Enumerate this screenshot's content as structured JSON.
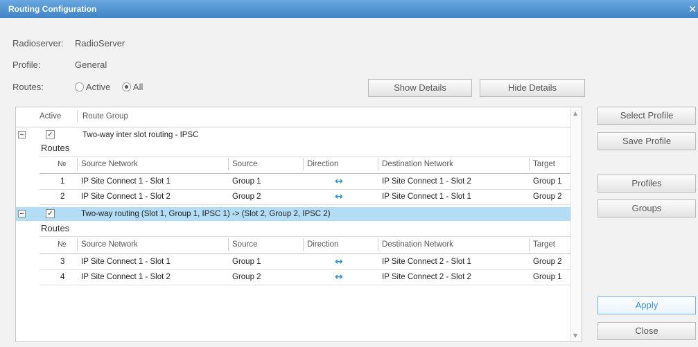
{
  "window": {
    "title": "Routing Configuration",
    "close_glyph": "✕"
  },
  "info": {
    "radioserver_label": "Radioserver:",
    "radioserver_value": "RadioServer",
    "profile_label": "Profile:",
    "profile_value": "General",
    "routes_label": "Routes:",
    "route_options": [
      {
        "label": "Active",
        "selected": false
      },
      {
        "label": "All",
        "selected": true
      }
    ]
  },
  "buttons": {
    "show_details": "Show Details",
    "hide_details": "Hide Details",
    "select_profile": "Select Profile",
    "save_profile": "Save Profile",
    "profiles": "Profiles",
    "groups": "Groups",
    "apply": "Apply",
    "close": "Close"
  },
  "grid": {
    "columns": {
      "active": "Active",
      "route_group": "Route Group"
    },
    "routes_label": "Routes",
    "sub_columns": {
      "no": "№",
      "source_network": "Source Network",
      "source": "Source",
      "direction": "Direction",
      "destination_network": "Destination Network",
      "target": "Target"
    },
    "groups": [
      {
        "active": true,
        "name": "Two-way inter slot routing - IPSC",
        "routes": [
          {
            "no": "1",
            "source_network": "IP Site Connect 1 - Slot 1",
            "source": "Group 1",
            "direction": "↔",
            "destination_network": "IP Site Connect 1 - Slot 2",
            "target": "Group 1"
          },
          {
            "no": "2",
            "source_network": "IP Site Connect 1 - Slot 2",
            "source": "Group 2",
            "direction": "↔",
            "destination_network": "IP Site Connect 1 - Slot 1",
            "target": "Group 2"
          }
        ]
      },
      {
        "active": true,
        "name": "Two-way routing (Slot 1, Group 1, IPSC 1) -> (Slot 2, Group 2, IPSC 2)",
        "routes": [
          {
            "no": "3",
            "source_network": "IP Site Connect 1 - Slot 1",
            "source": "Group 1",
            "direction": "↔",
            "destination_network": "IP Site Connect 2 - Slot 1",
            "target": "Group 2"
          },
          {
            "no": "4",
            "source_network": "IP Site Connect 1 - Slot 2",
            "source": "Group 2",
            "direction": "↔",
            "destination_network": "IP Site Connect 2 - Slot 2",
            "target": "Group 1"
          }
        ]
      }
    ]
  },
  "icons": {
    "check": "✓",
    "scroll_up": "▲",
    "scroll_down": "▼"
  },
  "colors": {
    "accent": "#3a8fd4",
    "selection": "#b3dcf5",
    "titlebar": "#4a8fd0"
  }
}
